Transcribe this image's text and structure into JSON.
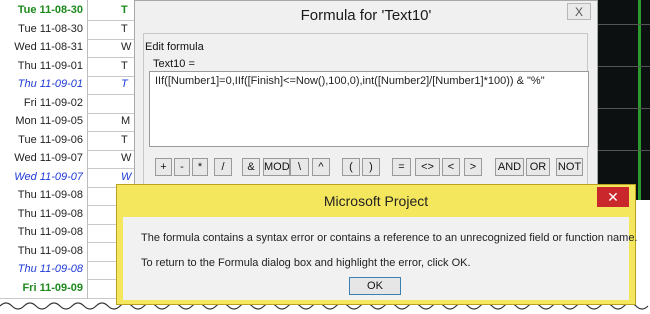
{
  "background": {
    "rows": [
      {
        "date": "Tue 11-08-30",
        "col2": "T",
        "style": "green"
      },
      {
        "date": "Tue 11-08-30",
        "col2": "T",
        "style": "normal"
      },
      {
        "date": "Wed 11-08-31",
        "col2": "W",
        "style": "normal"
      },
      {
        "date": "Thu 11-09-01",
        "col2": "T",
        "style": "normal"
      },
      {
        "date": "Thu 11-09-01",
        "col2": "T",
        "style": "blue"
      },
      {
        "date": "Fri 11-09-02",
        "col2": "",
        "style": "normal"
      },
      {
        "date": "Mon 11-09-05",
        "col2": "M",
        "style": "normal"
      },
      {
        "date": "Tue 11-09-06",
        "col2": "T",
        "style": "normal"
      },
      {
        "date": "Wed 11-09-07",
        "col2": "W",
        "style": "normal"
      },
      {
        "date": "Wed 11-09-07",
        "col2": "W",
        "style": "blue"
      },
      {
        "date": "Thu 11-09-08",
        "col2": "",
        "style": "normal"
      },
      {
        "date": "Thu 11-09-08",
        "col2": "",
        "style": "normal"
      },
      {
        "date": "Thu 11-09-08",
        "col2": "",
        "style": "normal"
      },
      {
        "date": "Thu 11-09-08",
        "col2": "",
        "style": "normal"
      },
      {
        "date": "Thu 11-09-08",
        "col2": "",
        "style": "blue"
      },
      {
        "date": "Fri 11-09-09",
        "col2": "",
        "style": "green"
      }
    ]
  },
  "formula_dialog": {
    "title": "Formula for 'Text10'",
    "close_label": "X",
    "group_label": "Edit formula",
    "field_label": "Text10 =",
    "formula_text": "IIf([Number1]=0,IIf([Finish]<=Now(),100,0),int([Number2]/[Number1]*100)) & \"%\"",
    "operators": [
      "+",
      "-",
      "*",
      "/",
      "&",
      "MOD",
      "\\",
      "^",
      "(",
      ")",
      "=",
      "<>",
      "<",
      ">",
      "AND",
      "OR",
      "NOT"
    ]
  },
  "message_box": {
    "title": "Microsoft Project",
    "close_label": "✕",
    "line1": "The formula contains a syntax error or contains a reference to an unrecognized field or function name.",
    "line2": "To return to the Formula dialog box and highlight the error, click OK.",
    "ok_label": "OK"
  },
  "colors": {
    "message_title_bar": "#f4e75e",
    "close_button": "#c9272c",
    "green_date": "#1e8a1e",
    "blue_date": "#1f3bd6"
  }
}
